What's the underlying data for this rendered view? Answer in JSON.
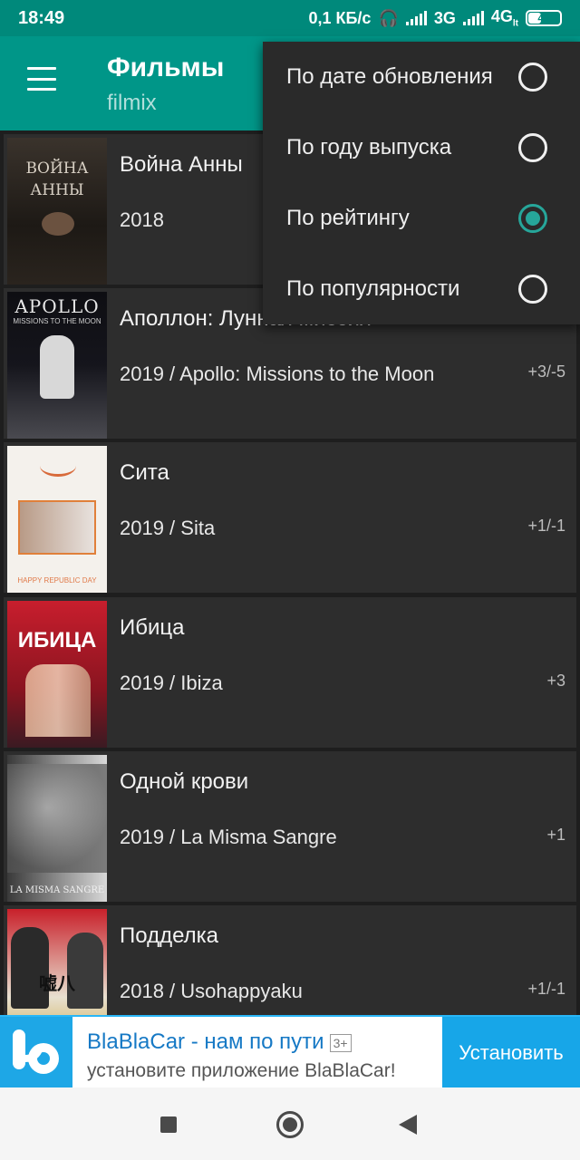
{
  "status": {
    "time": "18:49",
    "speed": "0,1 КБ/с",
    "net1": "3G",
    "net2": "4G",
    "net2_suffix": "lt",
    "battery": "41",
    "battery_level": 0.41
  },
  "appbar": {
    "title": "Фильмы",
    "subtitle": "filmix"
  },
  "sort_menu": {
    "items": [
      {
        "label": "По дате обновления",
        "checked": false
      },
      {
        "label": "По году выпуска",
        "checked": false
      },
      {
        "label": "По рейтингу",
        "checked": true
      },
      {
        "label": "По популярности",
        "checked": false
      }
    ]
  },
  "movies": [
    {
      "title": "Война Анны",
      "subtitle": "2018",
      "score": "",
      "poster_text": "ВОЙНА АННЫ"
    },
    {
      "title": "Аполлон: Лунная миссия",
      "subtitle": "2019 / Apollo: Missions to the Moon",
      "score": "+3/-5",
      "poster_text": "APOLLO",
      "poster_sub": "MISSIONS TO THE MOON"
    },
    {
      "title": "Сита",
      "subtitle": "2019 / Sita",
      "score": "+1/-1",
      "poster_text": "HAPPY REPUBLIC DAY"
    },
    {
      "title": "Ибица",
      "subtitle": "2019 / Ibiza",
      "score": "+3",
      "poster_text": "ИБИЦА"
    },
    {
      "title": "Одной крови",
      "subtitle": "2019 / La Misma Sangre",
      "score": "+1",
      "poster_text": "LA MISMA SANGRE"
    },
    {
      "title": "Подделка",
      "subtitle": "2018 / Usohappyaku",
      "score": "+1/-1",
      "poster_text": "嘘八"
    }
  ],
  "ad": {
    "title": "BlaBlaCar - нам по пути",
    "badge": "3+",
    "subtitle": "установите приложение BlaBlaCar!",
    "button": "Установить"
  },
  "colors": {
    "accent": "#009688",
    "statusbar": "#00897b",
    "radio_checked": "#26a69a",
    "ad_blue": "#17a6e8"
  }
}
